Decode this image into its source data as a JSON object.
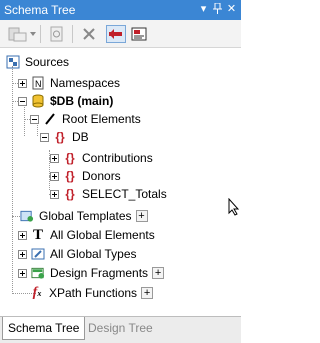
{
  "window": {
    "title": "Schema Tree",
    "pin_glyph": "x",
    "dropdown_glyph": "▾"
  },
  "tree": {
    "sources": "Sources",
    "namespaces": "Namespaces",
    "db_main": "$DB (main)",
    "root_elements": "Root Elements",
    "db": "DB",
    "contributions": "Contributions",
    "donors": "Donors",
    "select_totals": "SELECT_Totals",
    "global_templates": "Global Templates",
    "all_global_elements": "All Global Elements",
    "all_global_types": "All Global Types",
    "design_fragments": "Design Fragments",
    "xpath_functions": "XPath Functions",
    "add_glyph": "+"
  },
  "tabs": [
    {
      "label": "Schema Tree",
      "active": true
    },
    {
      "label": "Design Tree",
      "active": false
    }
  ],
  "colors": {
    "titlebar": "#3b86d4",
    "accent_red": "#c0202a",
    "db_yellow": "#f1c232"
  }
}
